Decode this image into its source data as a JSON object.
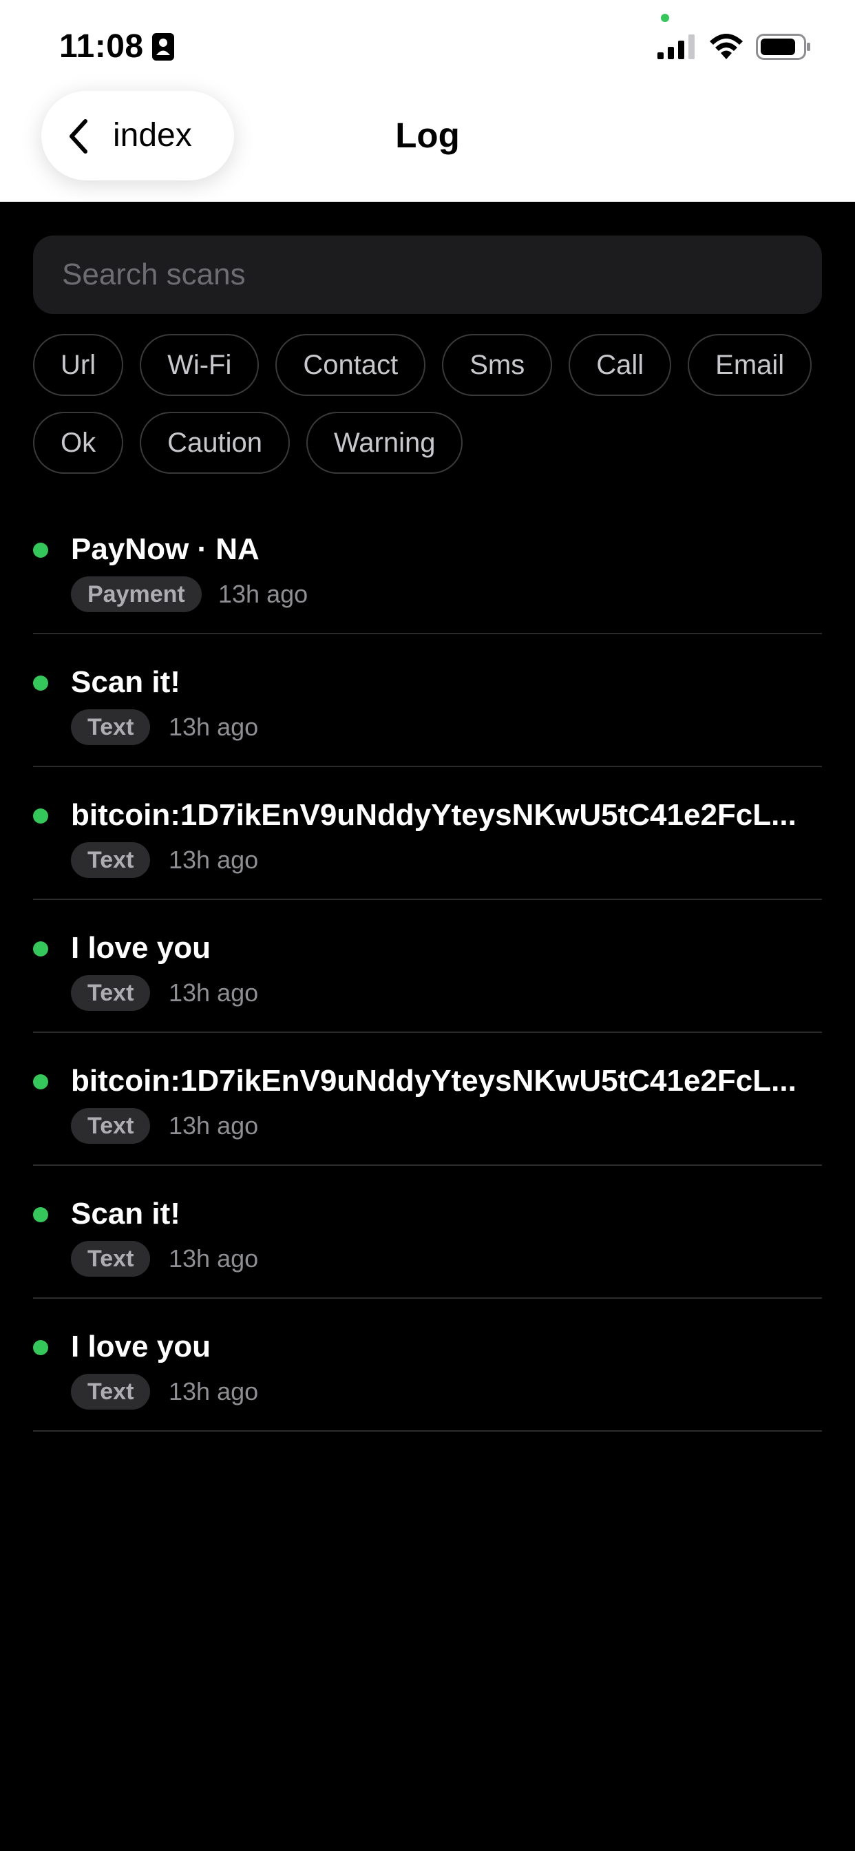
{
  "status_bar": {
    "time": "11:08",
    "colors": {
      "mic_indicator": "#34c759"
    },
    "icons": [
      "person-card-icon",
      "cellular-signal-icon",
      "wifi-icon",
      "battery-icon"
    ]
  },
  "nav": {
    "back_label": "index",
    "title": "Log",
    "back_icon": "chevron-left-icon"
  },
  "search": {
    "placeholder": "Search scans",
    "value": ""
  },
  "filters": {
    "row1": [
      "Url",
      "Wi-Fi",
      "Contact",
      "Sms",
      "Call",
      "Email"
    ],
    "row2": [
      "Ok",
      "Caution",
      "Warning"
    ]
  },
  "scans": [
    {
      "title": "PayNow · NA",
      "type": "Payment",
      "time": "13h ago"
    },
    {
      "title": "Scan it!",
      "type": "Text",
      "time": "13h ago"
    },
    {
      "title": "bitcoin:1D7ikEnV9uNddyYteysNKwU5tC41e2FcL...",
      "type": "Text",
      "time": "13h ago"
    },
    {
      "title": "I love you",
      "type": "Text",
      "time": "13h ago"
    },
    {
      "title": "bitcoin:1D7ikEnV9uNddyYteysNKwU5tC41e2FcL...",
      "type": "Text",
      "time": "13h ago"
    },
    {
      "title": "Scan it!",
      "type": "Text",
      "time": "13h ago"
    },
    {
      "title": "I love you",
      "type": "Text",
      "time": "13h ago"
    }
  ],
  "colors": {
    "background": "#000000",
    "header_background": "#ffffff",
    "status_ok": "#34c759",
    "search_background": "#1c1c1e",
    "chip_border": "#3a3a3c",
    "badge_background": "#2c2c2e"
  }
}
